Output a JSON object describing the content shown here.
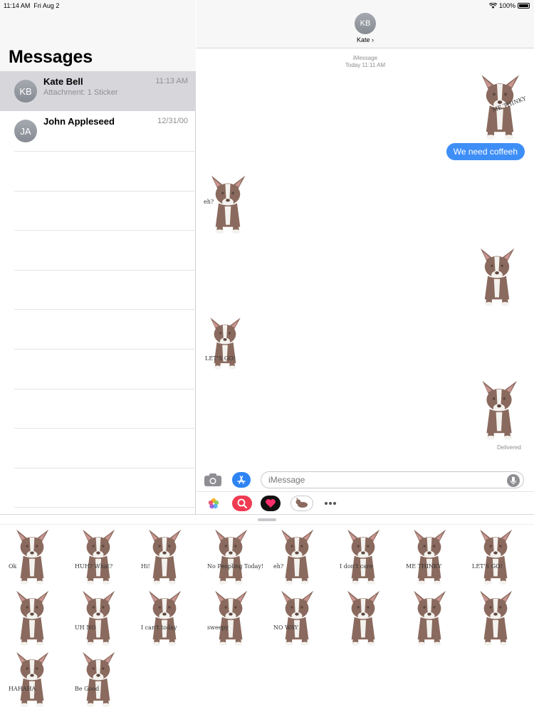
{
  "status_bar": {
    "time": "11:14 AM",
    "date": "Fri Aug 2",
    "battery": "100%"
  },
  "sidebar": {
    "title": "Messages",
    "conversations": [
      {
        "initials": "KB",
        "name": "Kate Bell",
        "preview": "Attachment: 1 Sticker",
        "date": "11:13 AM",
        "selected": true
      },
      {
        "initials": "JA",
        "name": "John Appleseed",
        "preview": "",
        "date": "12/31/00",
        "selected": false
      }
    ]
  },
  "chat": {
    "header": {
      "initials": "KB",
      "name": "Kate",
      "chevron": "›"
    },
    "meta": {
      "service": "iMessage",
      "time": "Today 11:11 AM"
    },
    "messages": [
      {
        "type": "sticker",
        "side": "right",
        "caption": "ME THINKY"
      },
      {
        "type": "text",
        "side": "right",
        "text": "We need coffeeh"
      },
      {
        "type": "sticker",
        "side": "left",
        "caption": "eh?"
      },
      {
        "type": "sticker",
        "side": "right",
        "caption": ""
      },
      {
        "type": "sticker",
        "side": "left",
        "caption": "LET'S GO!"
      },
      {
        "type": "sticker",
        "side": "right",
        "caption": ""
      }
    ],
    "delivered": "Delivered",
    "input_placeholder": "iMessage"
  },
  "app_drawer": {
    "icons": [
      "photos-icon",
      "search-images-icon",
      "digital-touch-icon",
      "sticker-pack-icon",
      "more-icon"
    ]
  },
  "sticker_drawer": {
    "stickers": [
      {
        "caption": "Ok"
      },
      {
        "caption": "HUH? What?"
      },
      {
        "caption": "Hi!"
      },
      {
        "caption": "No Peopling Today!"
      },
      {
        "caption": "eh?"
      },
      {
        "caption": "I don't care"
      },
      {
        "caption": "ME THINKY"
      },
      {
        "caption": "LET'S GO!"
      },
      {
        "caption": ""
      },
      {
        "caption": "UH NO"
      },
      {
        "caption": "I can't today"
      },
      {
        "caption": "sweepy"
      },
      {
        "caption": "NO WAY"
      },
      {
        "caption": ""
      },
      {
        "caption": ""
      },
      {
        "caption": ""
      },
      {
        "caption": "HAHAHA"
      },
      {
        "caption": "Be Good"
      }
    ]
  },
  "colors": {
    "accent": "#3e8ef7",
    "dog": "#8a6a5e",
    "dog_dark": "#5e4840",
    "ear_inner": "#c99590",
    "white": "#f4f2ee"
  }
}
